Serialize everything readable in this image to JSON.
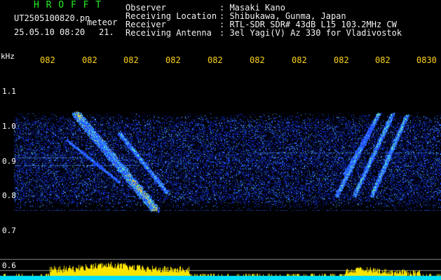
{
  "header": {
    "logo": "H R O F F T",
    "filename": "UT2505100820.pn",
    "meteor_label": "meteor",
    "datetime": "25.05.10 08:20",
    "count": "21.",
    "fields": [
      {
        "label": "Observer",
        "value": ": Masaki Kano"
      },
      {
        "label": "Receiving Location",
        "value": ": Shibukawa, Gunma, Japan"
      },
      {
        "label": "Receiver",
        "value": ": RTL-SDR SDR# 43dB L15 103.2MHz CW"
      },
      {
        "label": "Receiving Antenna",
        "value": ": 3el Yagi(V) Az 330 for Vladivostok"
      }
    ]
  },
  "axes": {
    "y_unit": "kHz",
    "y_ticks": [
      "1.1",
      "1.0",
      "0.9",
      "0.8",
      "0.7",
      "0.6"
    ],
    "x_ticks": [
      "082",
      "082",
      "082",
      "082",
      "082",
      "082",
      "082",
      "082",
      "082",
      "0830"
    ]
  },
  "colors": {
    "background": "#000000",
    "header_green": "#22ee22",
    "header_white": "#f2f2f2",
    "time_label": "#ffd21a",
    "strip_yellow": "#ffe600",
    "strip_cyan": "#00e5ff"
  }
}
